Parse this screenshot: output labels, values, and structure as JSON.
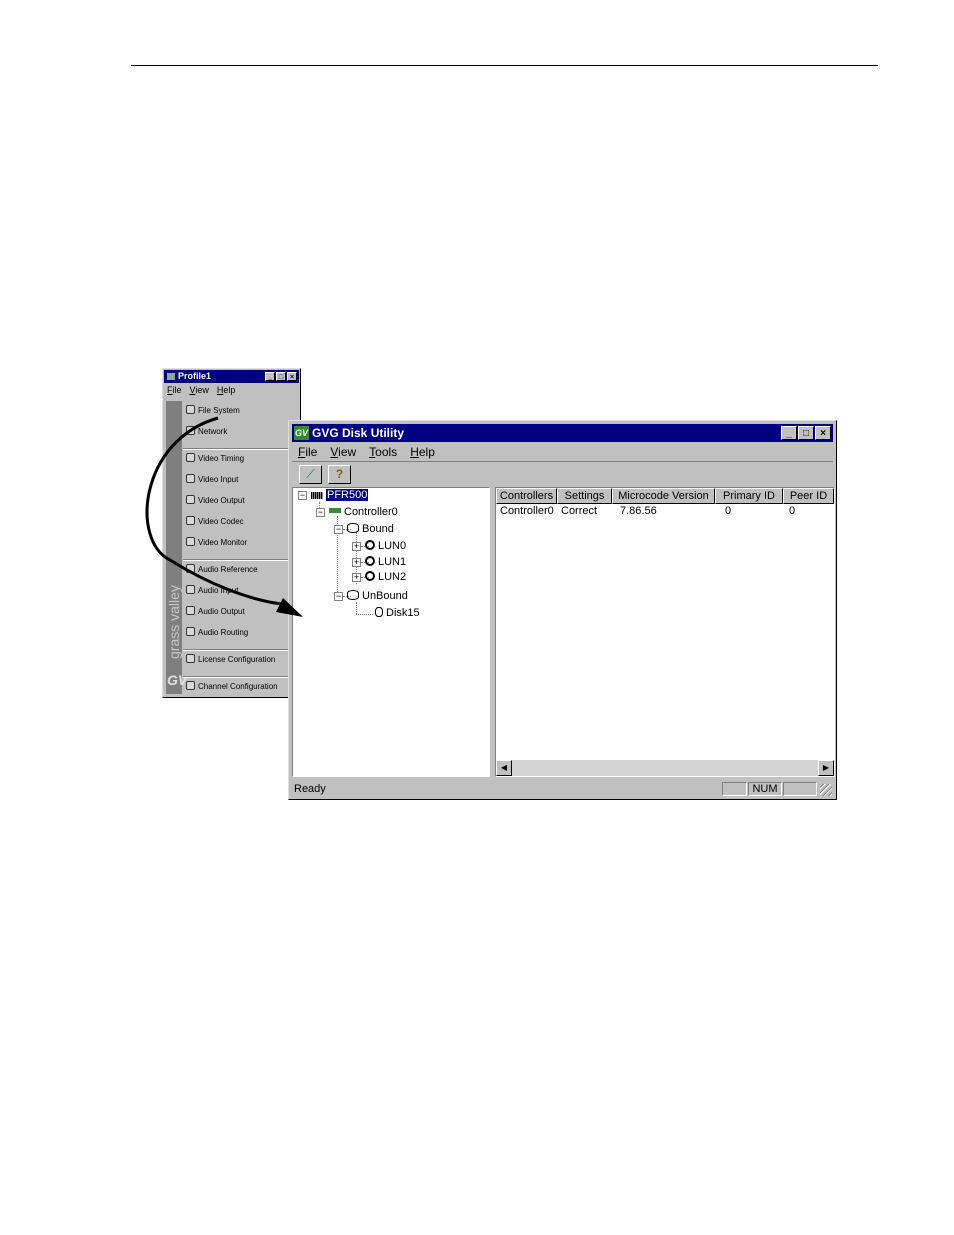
{
  "profile_window": {
    "title": "Profile1",
    "menu": [
      "File",
      "View",
      "Help"
    ],
    "brand": "grass valley",
    "logo": "GV",
    "items": [
      {
        "label": "File System",
        "icon": "file-system-icon"
      },
      {
        "label": "Network",
        "icon": "network-icon"
      },
      {
        "label": "Video Timing",
        "icon": "video-timing-icon"
      },
      {
        "label": "Video Input",
        "icon": "video-input-icon"
      },
      {
        "label": "Video Output",
        "icon": "video-output-icon"
      },
      {
        "label": "Video Codec",
        "icon": "video-codec-icon"
      },
      {
        "label": "Video Monitor",
        "icon": "video-monitor-icon"
      },
      {
        "label": "Audio Reference",
        "icon": "audio-reference-icon"
      },
      {
        "label": "Audio Input",
        "icon": "audio-input-icon"
      },
      {
        "label": "Audio Output",
        "icon": "audio-output-icon"
      },
      {
        "label": "Audio Routing",
        "icon": "audio-routing-icon"
      },
      {
        "label": "License Configuration",
        "icon": "license-icon"
      },
      {
        "label": "Channel Configuration",
        "icon": "channel-icon"
      }
    ]
  },
  "disk_utility": {
    "title": "GVG Disk Utility",
    "logo": "GV",
    "menu": [
      "File",
      "View",
      "Tools",
      "Help"
    ],
    "toolbar": [
      {
        "name": "graph-icon",
        "glyph": "⟋"
      },
      {
        "name": "help-icon",
        "glyph": "?"
      }
    ],
    "tree": {
      "root": "PFR500",
      "controller": "Controller0",
      "bound": "Bound",
      "luns": [
        "LUN0",
        "LUN1",
        "LUN2"
      ],
      "unbound": "UnBound",
      "disk": "Disk15"
    },
    "list": {
      "columns": [
        "Controllers",
        "Settings",
        "Microcode Version",
        "Primary ID",
        "Peer ID"
      ],
      "rows": [
        [
          "Controller0",
          "Correct",
          "7.86.56",
          "0",
          "0"
        ]
      ]
    },
    "status": {
      "text": "Ready",
      "num": "NUM"
    }
  },
  "colors": {
    "titlebar": "#000080",
    "window": "#c0c0c0",
    "selection": "#000080"
  }
}
